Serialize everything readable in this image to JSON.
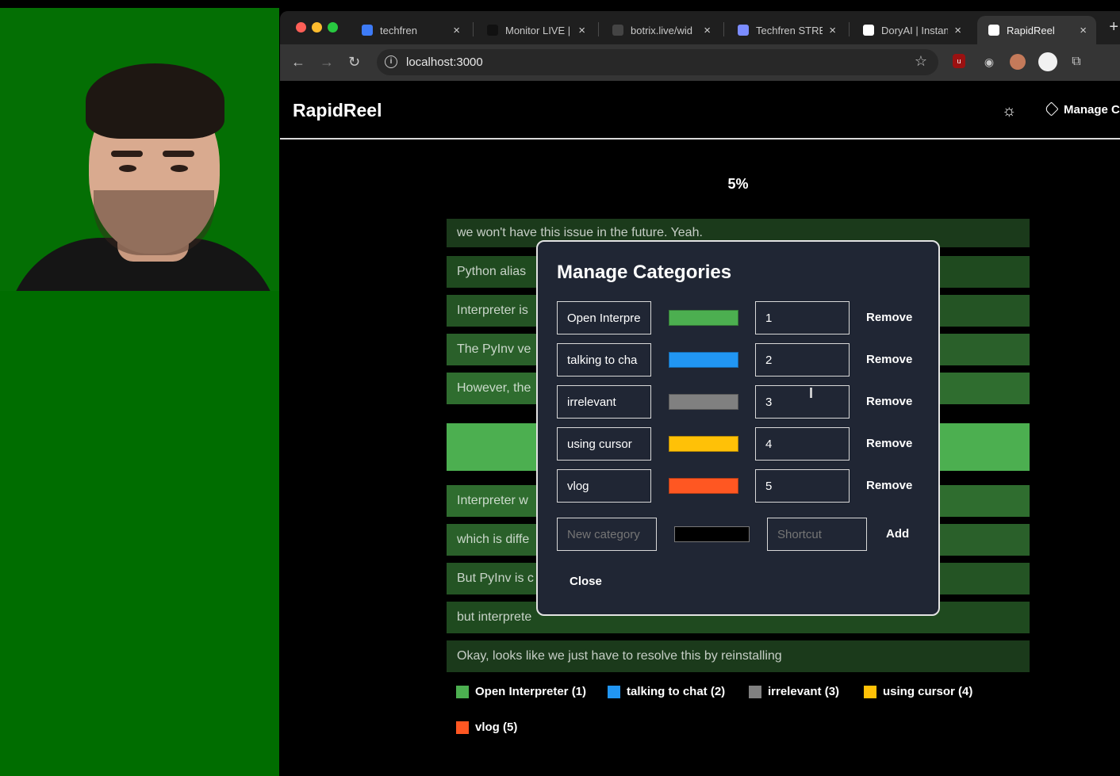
{
  "browser": {
    "tabs": [
      {
        "title": "techfren",
        "icon": "rocket-icon",
        "color": "#3d7bf7",
        "active": false
      },
      {
        "title": "Monitor LIVE |",
        "icon": "tiktok-icon",
        "color": "#111111",
        "active": false
      },
      {
        "title": "botrix.live/wid",
        "icon": "botrix-icon",
        "color": "#444444",
        "active": false
      },
      {
        "title": "Techfren STRE",
        "icon": "stream-icon",
        "color": "#7b8cff",
        "active": false
      },
      {
        "title": "DoryAI | Instan",
        "icon": "dory-icon",
        "color": "#ffffff",
        "active": false
      },
      {
        "title": "RapidReel",
        "icon": "triangle-icon",
        "color": "#ffffff",
        "active": true
      }
    ],
    "url": "localhost:3000"
  },
  "app": {
    "brand": "RapidReel",
    "manage_link": "Manage C",
    "progress": "5%"
  },
  "segments": [
    {
      "text": "we won't have this issue in the future. Yeah.",
      "color": "#1b3a1b"
    },
    {
      "text": "Python alias",
      "color": "#1f4a1f"
    },
    {
      "text": "Interpreter is",
      "color": "#245424"
    },
    {
      "text": "The PyInv ve",
      "color": "#2a602a"
    },
    {
      "text": "However, the",
      "color": "#2f6d2f"
    },
    {
      "text": "",
      "color": "#4caf50"
    },
    {
      "text": "Interpreter w",
      "color": "#2f6d2f"
    },
    {
      "text": "which is diffe",
      "color": "#2a602a"
    },
    {
      "text": "But PyInv is c",
      "color": "#245424"
    },
    {
      "text": "but interprete",
      "color": "#1f4a1f"
    },
    {
      "text": "Okay, looks like we just have to resolve this by reinstalling",
      "color": "#1b3a1b"
    }
  ],
  "modal": {
    "title": "Manage Categories",
    "categories": [
      {
        "name": "Open Interpre",
        "color": "#4caf50",
        "shortcut": "1"
      },
      {
        "name": "talking to cha",
        "color": "#2196f3",
        "shortcut": "2"
      },
      {
        "name": "irrelevant",
        "color": "#808080",
        "shortcut": "3"
      },
      {
        "name": "using cursor",
        "color": "#ffc107",
        "shortcut": "4"
      },
      {
        "name": "vlog",
        "color": "#ff5722",
        "shortcut": "5"
      }
    ],
    "remove_label": "Remove",
    "new_category_placeholder": "New category",
    "new_category_color": "#000000",
    "shortcut_placeholder": "Shortcut",
    "add_label": "Add",
    "close_label": "Close"
  },
  "legend": [
    {
      "label": "Open Interpreter (1)",
      "color": "#4caf50"
    },
    {
      "label": "talking to chat (2)",
      "color": "#2196f3"
    },
    {
      "label": "irrelevant (3)",
      "color": "#808080"
    },
    {
      "label": "using cursor (4)",
      "color": "#ffc107"
    },
    {
      "label": "vlog (5)",
      "color": "#ff5722"
    }
  ]
}
